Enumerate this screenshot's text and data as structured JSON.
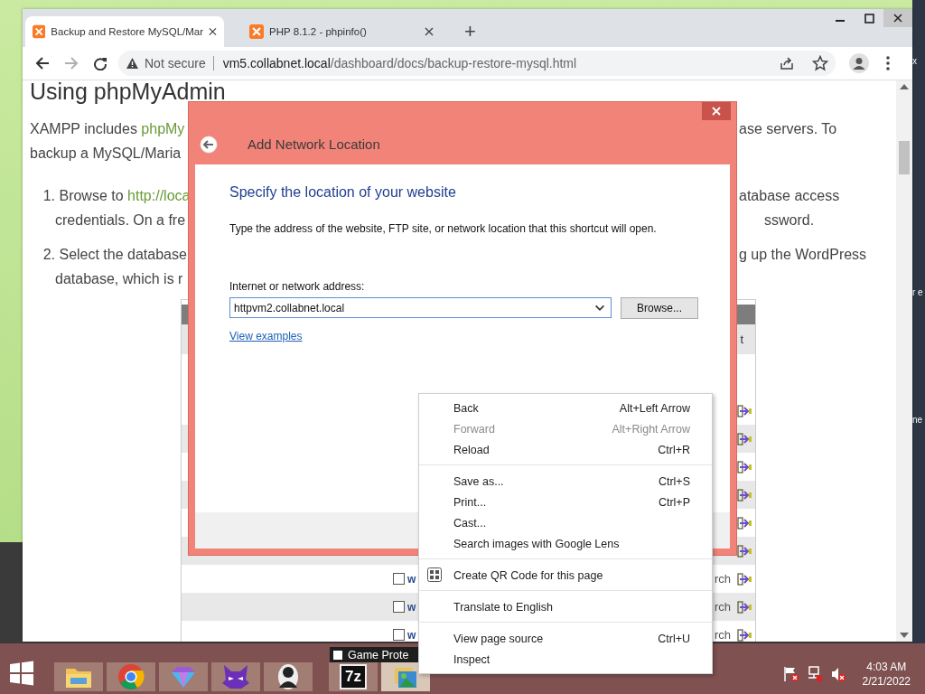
{
  "desktop_fragments": [
    "x",
    "r e",
    "ne"
  ],
  "browser": {
    "tabs": [
      {
        "title": "Backup and Restore MySQL/Mar",
        "selected": true
      },
      {
        "title": "PHP 8.1.2 - phpinfo()",
        "selected": false
      }
    ],
    "new_tab": "+",
    "forward_disabled": true,
    "security_label": "Not secure",
    "url_host": "vm5.collabnet.local",
    "url_path": "/dashboard/docs/backup-restore-mysql.html"
  },
  "page": {
    "heading": "Using phpMyAdmin",
    "lines": [
      {
        "kind": "para",
        "left": "XAMPP includes ",
        "link": "phpMy",
        "right": "ase servers. To"
      },
      {
        "kind": "para",
        "left": "backup a MySQL/Maria"
      },
      {
        "kind": "list",
        "number": "1.",
        "left": "Browse to ",
        "link": "http://loca",
        "right": "atabase access"
      },
      {
        "kind": "cont",
        "left": "credentials. On a fre",
        "right": "ssword."
      },
      {
        "kind": "list",
        "number": "2.",
        "left": "Select the database",
        "right": "g up the WordPress"
      },
      {
        "kind": "cont",
        "left": "database, which is r"
      }
    ],
    "embedded_screenshot": {
      "header": "t",
      "rows": [
        {
          "kind": "icon_only"
        },
        {
          "kind": "icon_only"
        },
        {
          "kind": "icon_only"
        },
        {
          "kind": "icon_only"
        },
        {
          "kind": "icon_only"
        },
        {
          "kind": "icon_only"
        },
        {
          "kind": "full",
          "checked": false,
          "name": "w",
          "type": "rch"
        },
        {
          "kind": "full",
          "checked": false,
          "name": "w",
          "type": "rch"
        },
        {
          "kind": "full",
          "checked": false,
          "name": "w",
          "type": "rch"
        }
      ]
    }
  },
  "dialog": {
    "title": "Add Network Location",
    "heading": "Specify the location of your website",
    "description": "Type the address of the website, FTP site, or network location that this shortcut will open.",
    "address_label": "Internet or network address:",
    "address_value": "httpvm2.collabnet.local",
    "browse_button": "Browse...",
    "examples_link": "View examples"
  },
  "context_menu": {
    "groups": [
      [
        {
          "kind": "plain",
          "label": "Back",
          "shortcut": "Alt+Left Arrow",
          "disabled": false
        },
        {
          "kind": "plain",
          "label": "Forward",
          "shortcut": "Alt+Right Arrow",
          "disabled": true
        },
        {
          "kind": "plain",
          "label": "Reload",
          "shortcut": "Ctrl+R",
          "disabled": false
        }
      ],
      [
        {
          "kind": "plain",
          "label": "Save as...",
          "shortcut": "Ctrl+S",
          "disabled": false
        },
        {
          "kind": "plain",
          "label": "Print...",
          "shortcut": "Ctrl+P",
          "disabled": false
        },
        {
          "kind": "plain",
          "label": "Cast...",
          "disabled": false
        },
        {
          "kind": "plain",
          "label": "Search images with Google Lens",
          "disabled": false
        }
      ],
      [
        {
          "kind": "qr",
          "label": "Create QR Code for this page",
          "disabled": false
        }
      ],
      [
        {
          "kind": "plain",
          "label": "Translate to English",
          "disabled": false
        }
      ],
      [
        {
          "kind": "plain",
          "label": "View page source",
          "shortcut": "Ctrl+U",
          "disabled": false
        },
        {
          "kind": "plain",
          "label": "Inspect",
          "disabled": false
        }
      ]
    ]
  },
  "taskbar_window": {
    "title": "Game Prote",
    "checked": false
  },
  "taskbar": {
    "apps": [
      {
        "kind": "folder",
        "active": false
      },
      {
        "kind": "chrome",
        "active": false
      },
      {
        "kind": "gem",
        "active": false
      },
      {
        "kind": "cat",
        "active": false
      },
      {
        "kind": "person",
        "active": false
      },
      {
        "kind": "sevenzip",
        "label": "7z",
        "active": false
      },
      {
        "kind": "pictures",
        "active": true
      }
    ],
    "time": "4:03 AM",
    "date": "2/21/2022"
  }
}
